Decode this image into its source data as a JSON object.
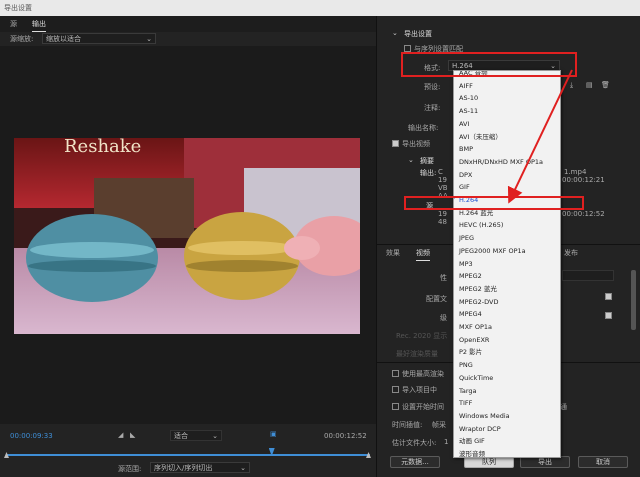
{
  "window": {
    "title": "导出设置"
  },
  "tabs": [
    {
      "label": "源"
    },
    {
      "label": "输出"
    }
  ],
  "source": {
    "scale_label": "源缩放:",
    "scale_value": "缩放以适合"
  },
  "preview": {
    "sign_text": "Reshake"
  },
  "player": {
    "time_current": "00:00:09:33",
    "fit_label": "适合",
    "time_total": "00:00:12:52",
    "progress_fraction": 0.73
  },
  "range": {
    "label": "源范围:",
    "value": "序列切入/序列切出"
  },
  "export_settings": {
    "header": "导出设置",
    "match_sequence_label": "与序列设置匹配",
    "format_label": "格式:",
    "format_value": "H.264",
    "preset_label": "预设:",
    "comment_label": "注释:",
    "output_name_label": "输出名称:",
    "export_video_label": "导出视频",
    "summary_label": "摘要",
    "output_label": "输出:",
    "output_lines": [
      "C",
      "19",
      "VB",
      "AA",
      "源",
      "19",
      "48"
    ],
    "output_file_tail": "1.mp4",
    "output_time": "00:00:12:21",
    "source_time": "00:00:12:52"
  },
  "format_options": [
    {
      "label": "AAC 音频",
      "selected": false
    },
    {
      "label": "AIFF",
      "selected": false
    },
    {
      "label": "AS-10",
      "selected": false
    },
    {
      "label": "AS-11",
      "selected": false
    },
    {
      "label": "AVI",
      "selected": false
    },
    {
      "label": "AVI（未压缩）",
      "selected": false
    },
    {
      "label": "BMP",
      "selected": false
    },
    {
      "label": "DNxHR/DNxHD MXF OP1a",
      "selected": false
    },
    {
      "label": "DPX",
      "selected": false
    },
    {
      "label": "GIF",
      "selected": false
    },
    {
      "label": "H.264",
      "selected": true
    },
    {
      "label": "H.264 蓝光",
      "selected": false
    },
    {
      "label": "HEVC (H.265)",
      "selected": false
    },
    {
      "label": "JPEG",
      "selected": false
    },
    {
      "label": "JPEG2000 MXF OP1a",
      "selected": false
    },
    {
      "label": "MP3",
      "selected": false
    },
    {
      "label": "MPEG2",
      "selected": false
    },
    {
      "label": "MPEG2 蓝光",
      "selected": false
    },
    {
      "label": "MPEG2-DVD",
      "selected": false
    },
    {
      "label": "MPEG4",
      "selected": false
    },
    {
      "label": "MXF OP1a",
      "selected": false
    },
    {
      "label": "OpenEXR",
      "selected": false
    },
    {
      "label": "P2 影片",
      "selected": false
    },
    {
      "label": "PNG",
      "selected": false
    },
    {
      "label": "QuickTime",
      "selected": false
    },
    {
      "label": "Targa",
      "selected": false
    },
    {
      "label": "TIFF",
      "selected": false
    },
    {
      "label": "Windows Media",
      "selected": false
    },
    {
      "label": "Wraptor DCP",
      "selected": false
    },
    {
      "label": "动画 GIF",
      "selected": false
    },
    {
      "label": "波形音频",
      "selected": false
    }
  ],
  "settings_tabs": [
    {
      "label": "效果"
    },
    {
      "label": "视频"
    },
    {
      "label": "发布"
    }
  ],
  "settings_rows": {
    "row1": "性",
    "row2": "配置文",
    "row3": "级"
  },
  "options": {
    "max_render": "使用最高渲染",
    "import_project": "导入项目中",
    "set_start_tc": "设置开始时间",
    "interpolation_label": "时间插值:",
    "interpolation_value": "帧采",
    "filesize_label": "估计文件大小:",
    "filesize_value": "1",
    "channel_tail": "通",
    "faded_row1": "Rec. 2020 显示",
    "faded_row2": "最好渲染质量"
  },
  "buttons": {
    "metadata": "元数据...",
    "queue": "队列",
    "export": "导出",
    "cancel": "取消"
  },
  "colors": {
    "accent_blue": "#3f8ed6",
    "highlight_red": "#e02020",
    "selected_blue": "#1a4fd0"
  }
}
